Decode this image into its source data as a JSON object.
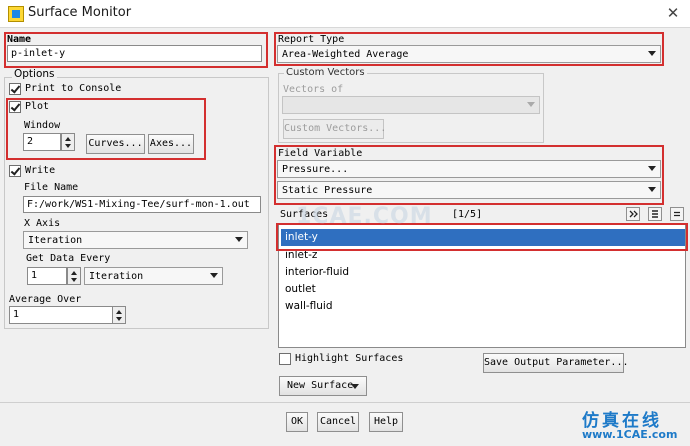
{
  "window": {
    "title": "Surface Monitor",
    "close_label": "✕"
  },
  "name": {
    "label": "Name",
    "value": "p-inlet-y"
  },
  "options": {
    "label": "Options",
    "print_to_console": {
      "label": "Print to Console",
      "checked": true
    },
    "plot": {
      "label": "Plot",
      "checked": true
    },
    "window_label": "Window",
    "window_value": "2",
    "curves_button": "Curves...",
    "axes_button": "Axes...",
    "write": {
      "label": "Write",
      "checked": true
    },
    "file_name_label": "File Name",
    "file_name_value": "F:/work/WS1-Mixing-Tee/surf-mon-1.out",
    "x_axis_label": "X Axis",
    "x_axis_value": "Iteration",
    "get_data_every_label": "Get Data Every",
    "get_data_every_value": "1",
    "get_data_every_unit": "Iteration",
    "average_over_label": "Average Over",
    "average_over_value": "1"
  },
  "report_type": {
    "label": "Report Type",
    "value": "Area-Weighted Average"
  },
  "custom_vectors": {
    "label": "Custom Vectors",
    "vectors_of_label": "Vectors of",
    "vectors_of_value": "",
    "button": "Custom Vectors..."
  },
  "field_variable": {
    "label": "Field Variable",
    "category": "Pressure...",
    "value": "Static Pressure"
  },
  "surfaces": {
    "label": "Surfaces",
    "count": "[1/5]",
    "items": [
      "inlet-y",
      "inlet-z",
      "interior-fluid",
      "outlet",
      "wall-fluid"
    ],
    "selected": "inlet-y"
  },
  "highlight_surfaces": {
    "label": "Highlight Surfaces",
    "checked": false
  },
  "save_output_parameter_button": "Save Output Parameter...",
  "new_surface_button": "New Surface",
  "footer": {
    "ok": "OK",
    "cancel": "Cancel",
    "help": "Help"
  },
  "watermark": {
    "center": "1CAE.COM",
    "corner_cn": "仿真在线",
    "corner_url": "www.1CAE.com"
  },
  "colors": {
    "highlight_box": "#d32f2f",
    "selection": "#2f6fc0",
    "watermark": "#1e7ac8"
  }
}
